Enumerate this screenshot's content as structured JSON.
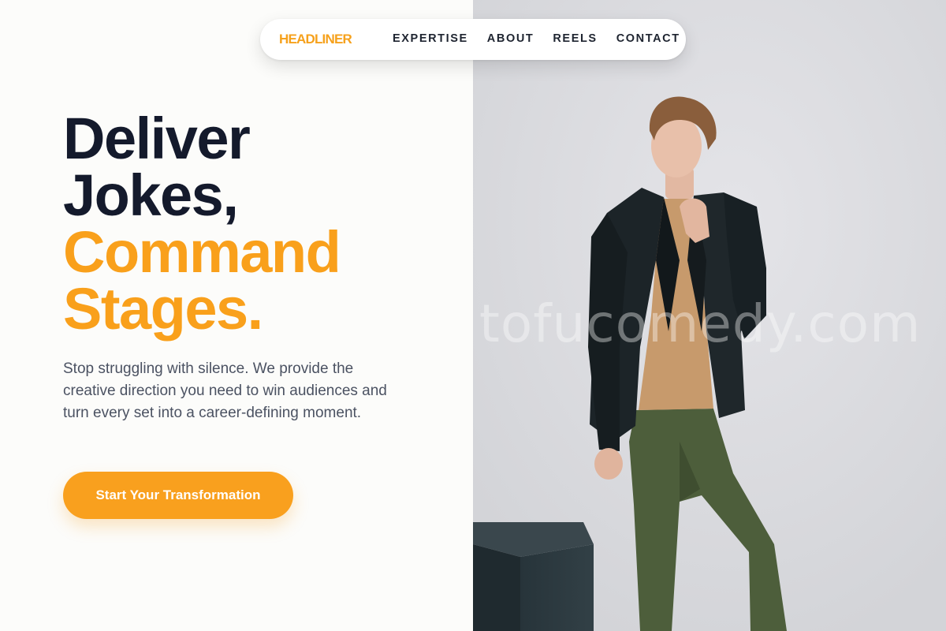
{
  "nav": {
    "logo": "HEADLINER",
    "links": [
      "EXPERTISE",
      "ABOUT",
      "REELS",
      "CONTACT"
    ]
  },
  "hero": {
    "title_dark": [
      "Deliver",
      "Jokes,"
    ],
    "title_accent": [
      "Command",
      "Stages."
    ],
    "description": "Stop struggling with silence. We provide the creative direction you need to win audiences and turn every set into a career-defining moment.",
    "cta_label": "Start Your Transformation"
  },
  "photo": {
    "watermark": "tofucomedy.com"
  },
  "colors": {
    "accent": "#f9a01b",
    "heading": "#141a2c",
    "body_text": "#4b5262",
    "background": "#fcfcfa"
  }
}
